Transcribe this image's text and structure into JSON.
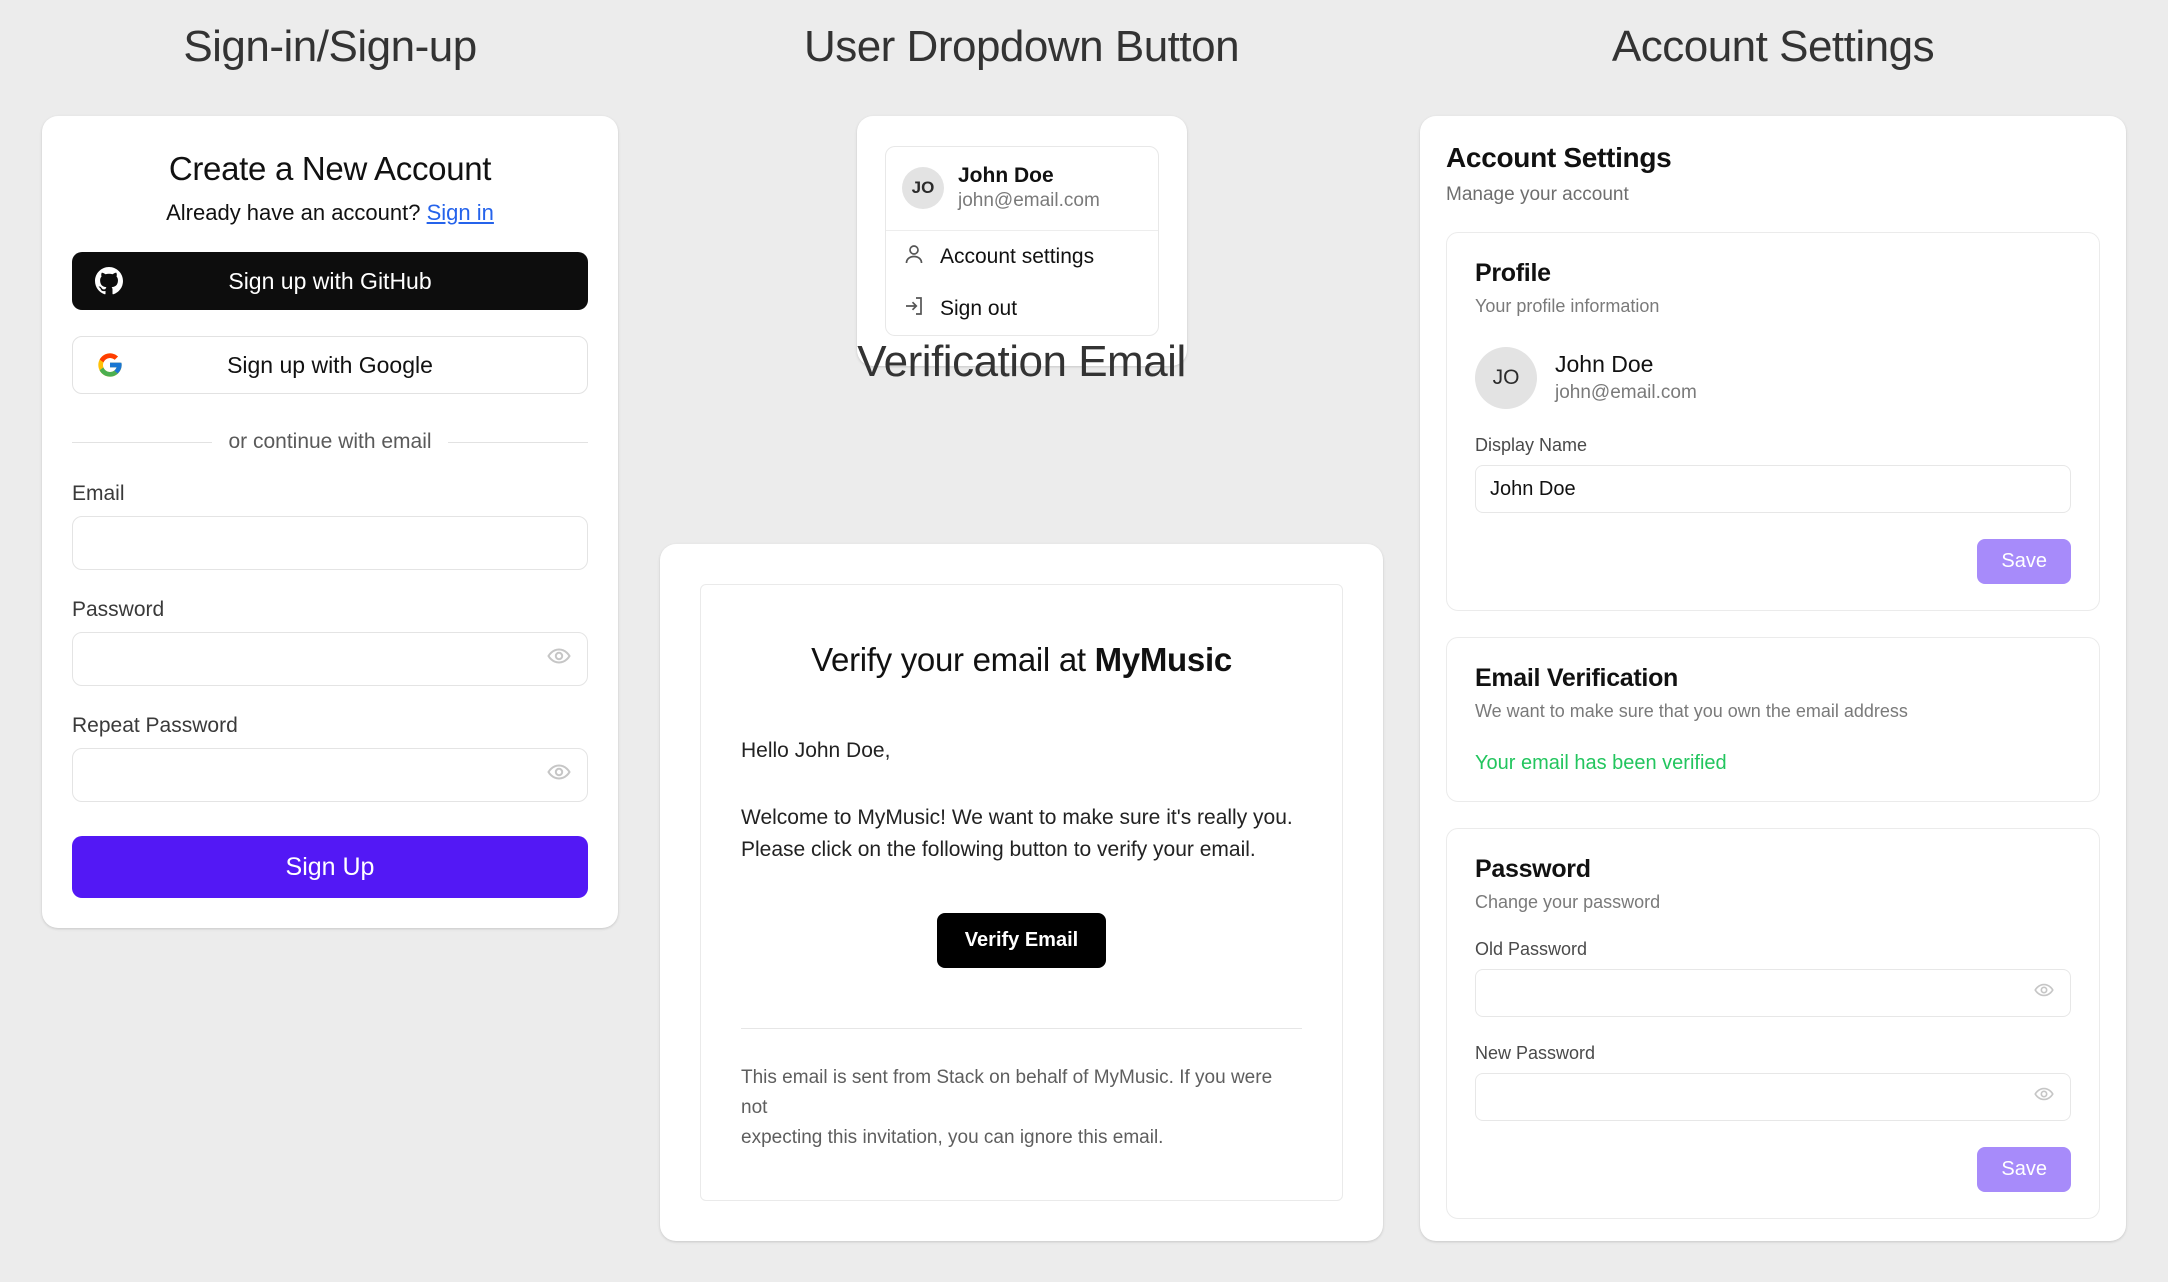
{
  "columns": {
    "signup_heading": "Sign-in/Sign-up",
    "dropdown_heading": "User Dropdown Button",
    "account_heading": "Account Settings"
  },
  "signup": {
    "title": "Create a New Account",
    "already_text": "Already have an account?",
    "signin_link": "Sign in",
    "github_button": "Sign up with GitHub",
    "google_button": "Sign up with Google",
    "divider_text": "or continue with email",
    "email_label": "Email",
    "email_value": "",
    "password_label": "Password",
    "password_value": "",
    "repeat_label": "Repeat Password",
    "repeat_value": "",
    "submit_button": "Sign Up"
  },
  "dropdown": {
    "avatar_initials": "JO",
    "name": "John Doe",
    "email": "john@email.com",
    "items": [
      {
        "label": "Account settings",
        "icon": "user-icon"
      },
      {
        "label": "Sign out",
        "icon": "sign-out-icon"
      }
    ]
  },
  "email_section_heading": "Verification Email",
  "email": {
    "heading_prefix": "Verify your email at ",
    "heading_brand": "MyMusic",
    "greeting": "Hello John Doe,",
    "body_line1": "Welcome to MyMusic! We want to make sure it's really you.",
    "body_line2": "Please click on the following button to verify your email.",
    "button": "Verify Email",
    "footer_line1": "This email is sent from Stack on behalf of MyMusic. If you were not",
    "footer_line2": "expecting this invitation, you can ignore this email."
  },
  "account": {
    "title": "Account Settings",
    "subtitle": "Manage your account",
    "profile": {
      "heading": "Profile",
      "subtitle": "Your profile information",
      "avatar_initials": "JO",
      "name": "John Doe",
      "email": "john@email.com",
      "display_name_label": "Display Name",
      "display_name_value": "John Doe",
      "save_button": "Save"
    },
    "verification": {
      "heading": "Email Verification",
      "subtitle": "We want to make sure that you own the email address",
      "status": "Your email has been verified"
    },
    "password": {
      "heading": "Password",
      "subtitle": "Change your password",
      "old_label": "Old Password",
      "old_value": "",
      "new_label": "New Password",
      "new_value": "",
      "save_button": "Save"
    }
  },
  "colors": {
    "page_bg": "#ECECEC",
    "primary": "#5318F5",
    "save_muted": "#A78BFA",
    "link": "#2563EB",
    "success": "#22C55E",
    "dark": "#0D0D0D"
  }
}
